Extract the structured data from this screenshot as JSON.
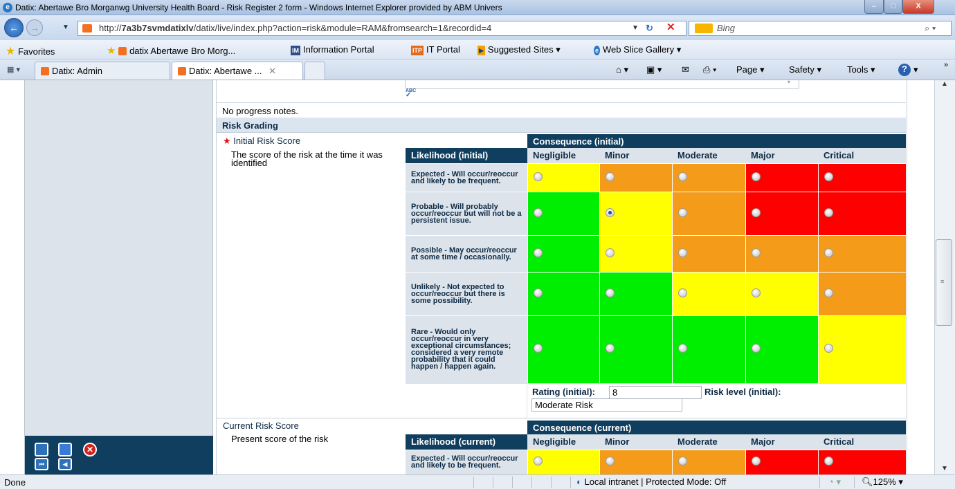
{
  "window": {
    "title": "Datix: Abertawe Bro Morganwg University Health Board - Risk Register 2 form - Windows Internet Explorer provided by ABM Univers",
    "minimize": "–",
    "maximize": "□",
    "close": "X"
  },
  "address": {
    "url_prefix": "http://",
    "url_host": "7a3b7svmdatixlv",
    "url_path": "/datix/live/index.php?action=risk&module=RAM&fromsearch=1&recordid=4",
    "search_engine": "Bing"
  },
  "favorites": {
    "favorites_label": "Favorites",
    "items": [
      "datix Abertawe Bro Morg...",
      "Information Portal",
      "IT Portal",
      "Suggested Sites ▾",
      "Web Slice Gallery ▾"
    ],
    "icons": [
      "IM",
      "ITP"
    ]
  },
  "tabs": {
    "items": [
      "Datix: Admin",
      "Datix: Abertawe ..."
    ],
    "close_glyph": "✕",
    "commands": [
      "Page ▾",
      "Safety ▾",
      "Tools ▾"
    ]
  },
  "form": {
    "spell_icon": "ABC",
    "progress_notes": "No progress notes.",
    "section_title": "Risk Grading",
    "required_mark": "★",
    "initial": {
      "label": "Initial Risk Score",
      "description": "The score of the risk at the time it was identified",
      "consequence_header": "Consequence (initial)",
      "likelihood_header": "Likelihood (initial)",
      "rating_label": "Rating (initial):",
      "rating_value": "8",
      "risk_level_label": "Risk level (initial):",
      "risk_level_value": "Moderate Risk"
    },
    "current": {
      "label": "Current Risk Score",
      "description": "Present score of the risk",
      "consequence_header": "Consequence (current)",
      "likelihood_header": "Likelihood (current)"
    },
    "consequences": [
      "Negligible",
      "Minor",
      "Moderate",
      "Major",
      "Critical"
    ],
    "likelihoods": [
      "Expected - Will occur/reoccur and likely to be frequent.",
      "Probable - Will probably occur/reoccur but will not be a persistent issue.",
      "Possible - May occur/reoccur at some time / occasionally.",
      "Unlikely - Not expected to occur/reoccur but there is some possibility.",
      "Rare - Would only occur/reoccur in very exceptional circumstances; considered a very remote probability that it could happen / happen again."
    ],
    "colors": {
      "y": "#ffff00",
      "o": "#f49c1a",
      "r": "#ff0000",
      "g": "#00ee00"
    },
    "matrix_colors": [
      [
        "y",
        "o",
        "o",
        "r",
        "r"
      ],
      [
        "g",
        "y",
        "o",
        "r",
        "r"
      ],
      [
        "g",
        "y",
        "o",
        "o",
        "o"
      ],
      [
        "g",
        "g",
        "y",
        "y",
        "o"
      ],
      [
        "g",
        "g",
        "g",
        "g",
        "y"
      ]
    ],
    "selected": {
      "row": 1,
      "col": 1
    }
  },
  "status": {
    "left": "Done",
    "zone": "Local intranet | Protected Mode: Off",
    "zoom": "125%"
  }
}
